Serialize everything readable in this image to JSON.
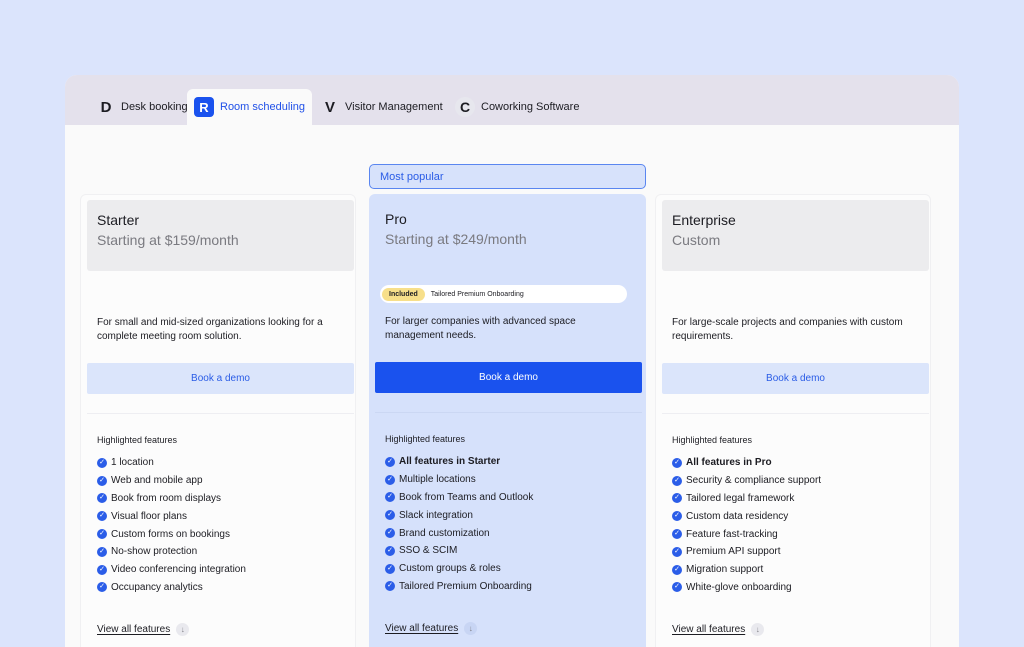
{
  "tabs": [
    {
      "letter": "D",
      "label": "Desk booking"
    },
    {
      "letter": "R",
      "label": "Room scheduling"
    },
    {
      "letter": "V",
      "label": "Visitor Management"
    },
    {
      "letter": "C",
      "label": "Coworking Software"
    }
  ],
  "popular_label": "Most popular",
  "plans": [
    {
      "name": "Starter",
      "price": "Starting at $159/month",
      "description": "For small and mid-sized organizations looking for a complete meeting room solution.",
      "cta": "Book a demo",
      "features_title": "Highlighted features",
      "features": [
        "1 location",
        "Web and mobile app",
        "Book from room displays",
        "Visual floor plans",
        "Custom forms on bookings",
        "No-show protection",
        "Video conferencing integration",
        "Occupancy analytics"
      ],
      "view_all": "View all features"
    },
    {
      "name": "Pro",
      "price": "Starting at $249/month",
      "included_tag": "Included",
      "included_text": "Tailored Premium Onboarding",
      "description": "For larger companies with advanced space management needs.",
      "cta": "Book a demo",
      "features_title": "Highlighted features",
      "features": [
        "All features in Starter",
        "Multiple locations",
        "Book from Teams and Outlook",
        "Slack integration",
        "Brand customization",
        "SSO & SCIM",
        "Custom groups & roles",
        "Tailored Premium Onboarding"
      ],
      "view_all": "View all features"
    },
    {
      "name": "Enterprise",
      "price": "Custom",
      "description": "For large-scale projects and companies with custom requirements.",
      "cta": "Book a demo",
      "features_title": "Highlighted features",
      "features": [
        "All features in Pro",
        "Security & compliance support",
        "Tailored legal framework",
        "Custom data residency",
        "Feature fast-tracking",
        "Premium API support",
        "Migration support",
        "White-glove onboarding"
      ],
      "view_all": "View all features"
    }
  ],
  "icons": {
    "check": "check-circle-icon",
    "arrow": "arrow-down-icon"
  },
  "colors": {
    "accent": "#1a52ee",
    "background": "#dbe4fc",
    "pro_card": "#d6e1fb",
    "included_tag": "#f7df8a"
  }
}
